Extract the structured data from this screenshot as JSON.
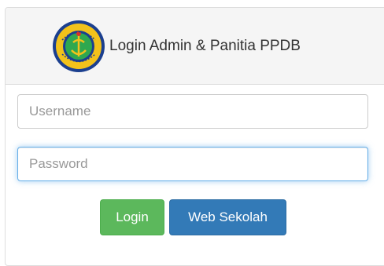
{
  "header": {
    "logo_icon": "school-emblem-icon",
    "title": "Login Admin & Panitia PPDB"
  },
  "form": {
    "username_placeholder": "Username",
    "username_value": "",
    "password_placeholder": "Password",
    "password_value": ""
  },
  "buttons": {
    "login_label": "Login",
    "web_label": "Web Sekolah"
  },
  "colors": {
    "login_button": "#5cb85c",
    "web_button": "#337ab7",
    "focus_border": "#66afe9",
    "heading_bg": "#f5f5f5"
  }
}
